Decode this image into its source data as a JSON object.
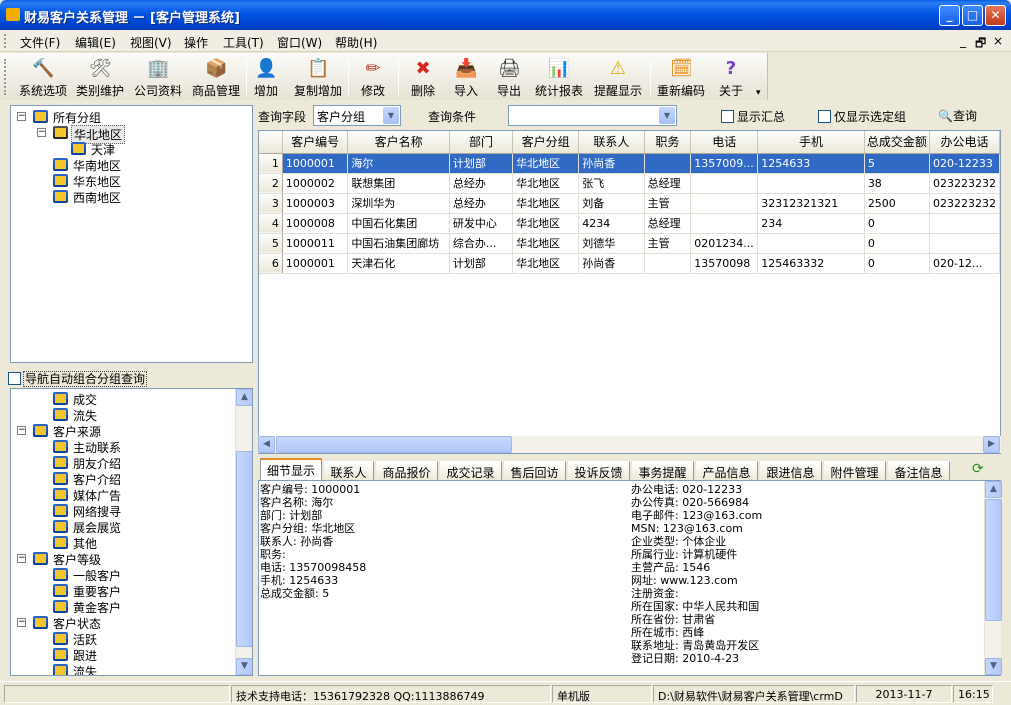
{
  "window": {
    "title": "财易客户关系管理 － [客户管理系统]",
    "minimize": "_",
    "maximize": "□",
    "close": "✕"
  },
  "menu": {
    "items": [
      "文件(F)",
      "编辑(E)",
      "视图(V)",
      "操作",
      "工具(T)",
      "窗口(W)",
      "帮助(H)"
    ],
    "mdi_min": "_",
    "mdi_restore": "🗗",
    "mdi_close": "×"
  },
  "toolbar": {
    "buttons": [
      {
        "label": "系统选项",
        "icon": "hammer-icon",
        "glyph": "🔨"
      },
      {
        "label": "类别维护",
        "icon": "tools-icon",
        "glyph": "🛠"
      },
      {
        "label": "公司资料",
        "icon": "company-icon",
        "glyph": "🏢"
      },
      {
        "label": "商品管理",
        "icon": "product-icon",
        "glyph": "📦"
      },
      {
        "label": "增加",
        "icon": "add-user-icon",
        "glyph": "👤"
      },
      {
        "label": "复制增加",
        "icon": "copy-add-icon",
        "glyph": "📋"
      },
      {
        "label": "修改",
        "icon": "pencil-icon",
        "glyph": "✏"
      },
      {
        "label": "删除",
        "icon": "delete-icon",
        "glyph": "✖"
      },
      {
        "label": "导入",
        "icon": "import-icon",
        "glyph": "📥"
      },
      {
        "label": "导出",
        "icon": "export-icon",
        "glyph": "🖨"
      },
      {
        "label": "统计报表",
        "icon": "chart-icon",
        "glyph": "📊"
      },
      {
        "label": "提醒显示",
        "icon": "reminder-icon",
        "glyph": "⚠"
      },
      {
        "label": "重新编码",
        "icon": "recode-icon",
        "glyph": "🗓"
      },
      {
        "label": "关于",
        "icon": "help-icon",
        "glyph": "?"
      }
    ],
    "more": "▾"
  },
  "tree": {
    "nodes": [
      {
        "label": "所有分组",
        "exp": "−"
      },
      {
        "label": "华北地区",
        "exp": "−"
      },
      {
        "label": "天津",
        "exp": ""
      },
      {
        "label": "华南地区",
        "exp": ""
      },
      {
        "label": "华东地区",
        "exp": ""
      },
      {
        "label": "西南地区",
        "exp": ""
      }
    ]
  },
  "nav_check": {
    "label": "导航自动组合分组查询"
  },
  "nav_tree": {
    "nodes": [
      {
        "label": "成交",
        "exp": ""
      },
      {
        "label": "流失",
        "exp": ""
      },
      {
        "label": "客户来源",
        "exp": "−"
      },
      {
        "label": "主动联系",
        "exp": ""
      },
      {
        "label": "朋友介绍",
        "exp": ""
      },
      {
        "label": "客户介绍",
        "exp": ""
      },
      {
        "label": "媒体广告",
        "exp": ""
      },
      {
        "label": "网络搜寻",
        "exp": ""
      },
      {
        "label": "展会展览",
        "exp": ""
      },
      {
        "label": "其他",
        "exp": ""
      },
      {
        "label": "客户等级",
        "exp": "−"
      },
      {
        "label": "一般客户",
        "exp": ""
      },
      {
        "label": "重要客户",
        "exp": ""
      },
      {
        "label": "黄金客户",
        "exp": ""
      },
      {
        "label": "客户状态",
        "exp": "−"
      },
      {
        "label": "活跃",
        "exp": ""
      },
      {
        "label": "跟进",
        "exp": ""
      },
      {
        "label": "流失",
        "exp": ""
      }
    ]
  },
  "query": {
    "field_label": "查询字段",
    "field_value": "客户分组",
    "condition_label": "查询条件",
    "condition_value": "",
    "show_summary": "显示汇总",
    "only_selected": "仅显示选定组",
    "query_button": "查询"
  },
  "grid": {
    "columns": [
      "客户编号",
      "客户名称",
      "部门",
      "客户分组",
      "联系人",
      "职务",
      "电话",
      "手机",
      "总成交金额",
      "办公电话"
    ],
    "rows": [
      [
        "1",
        "1000001",
        "海尔",
        "计划部",
        "华北地区",
        "孙尚香",
        "",
        "1357009...",
        "1254633",
        "5",
        "020-12233"
      ],
      [
        "2",
        "1000002",
        "联想集团",
        "总经办",
        "华北地区",
        "张飞",
        "总经理",
        "",
        "",
        "38",
        "023223232"
      ],
      [
        "3",
        "1000003",
        "深圳华为",
        "总经办",
        "华北地区",
        "刘备",
        "主管",
        "",
        "32312321321",
        "2500",
        "023223232"
      ],
      [
        "4",
        "1000008",
        "中国石化集团",
        "研发中心",
        "华北地区",
        "4234",
        "总经理",
        "",
        "234",
        "0",
        ""
      ],
      [
        "5",
        "1000011",
        "中国石油集团廊坊",
        "综合办...",
        "华北地区",
        "刘德华",
        "主管",
        "0201234...",
        "",
        "0",
        ""
      ],
      [
        "6",
        "1000001",
        "天津石化",
        "计划部",
        "华北地区",
        "孙尚香",
        "",
        "13570098",
        "125463332",
        "0",
        "020-12..."
      ]
    ]
  },
  "tabs": [
    "细节显示",
    "联系人",
    "商品报价",
    "成交记录",
    "售后回访",
    "投诉反馈",
    "事务提醒",
    "产品信息",
    "跟进信息",
    "附件管理",
    "备注信息"
  ],
  "detail": {
    "left": [
      "客户编号: 1000001",
      "客户名称: 海尔",
      "部门: 计划部",
      "客户分组: 华北地区",
      "联系人: 孙尚香",
      "职务:",
      "电话: 13570098458",
      "手机: 1254633",
      "总成交金额: 5"
    ],
    "right": [
      "办公电话: 020-12233",
      "办公传真: 020-566984",
      "电子邮件: 123@163.com",
      "MSN: 123@163.com",
      "企业类型: 个体企业",
      "所属行业: 计算机硬件",
      "主营产品: 1546",
      "网址: www.123.com",
      "注册资金:",
      "所在国家: 中华人民共和国",
      "所在省份: 甘肃省",
      "所在城市: 西峰",
      "联系地址: 青岛黄岛开发区",
      "登记日期: 2010-4-23"
    ]
  },
  "status": {
    "support": "技术支持电话：15361792328 QQ:1113886749",
    "edition": "单机版",
    "path": "D:\\财易软件\\财易客户关系管理\\crmD",
    "date": "2013-11-7",
    "time": "16:15"
  },
  "colors": {
    "titlebar": "#0054e3",
    "selection": "#316ac5",
    "active_tab_accent": "#e68b2c"
  }
}
